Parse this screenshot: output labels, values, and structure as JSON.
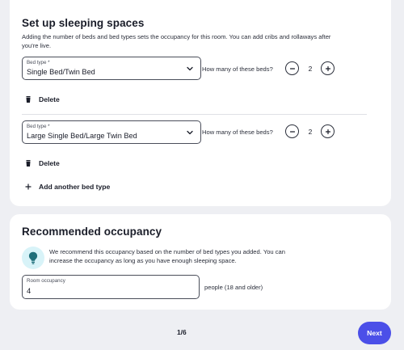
{
  "sleeping": {
    "title": "Set up sleeping spaces",
    "description_line1": "Adding the number of beds and bed types sets the occupancy for this room. You can add cribs and rollaways after",
    "description_line2": "you're live.",
    "beds": [
      {
        "select_label": "Bed type *",
        "select_value": "Single Bed/Twin Bed",
        "qty_label": "How many of these beds?",
        "qty_value": "2",
        "delete_label": "Delete"
      },
      {
        "select_label": "Bed type *",
        "select_value": "Large Single Bed/Large Twin Bed",
        "qty_label": "How many of these beds?",
        "qty_value": "2",
        "delete_label": "Delete"
      }
    ],
    "add_label": "Add another bed type"
  },
  "occupancy": {
    "title": "Recommended occupancy",
    "info_line1": "We recommend this occupancy based on the number of bed types you added. You can",
    "info_line2": "increase the occupancy as long as you have enough sleeping space.",
    "field_label": "Room occupancy",
    "field_value": "4",
    "suffix": "people (18 and older)"
  },
  "footer": {
    "pager": "1/6",
    "next_label": "Next"
  },
  "colors": {
    "accent": "#4b4fe8",
    "background": "#eeeff3",
    "info_bubble": "#d8f3f8"
  },
  "icons": {
    "dropdown": "chevron-down-icon",
    "decrement": "minus-icon",
    "increment": "plus-icon",
    "delete": "trash-icon",
    "add": "plus-icon",
    "info": "lightbulb-icon"
  }
}
